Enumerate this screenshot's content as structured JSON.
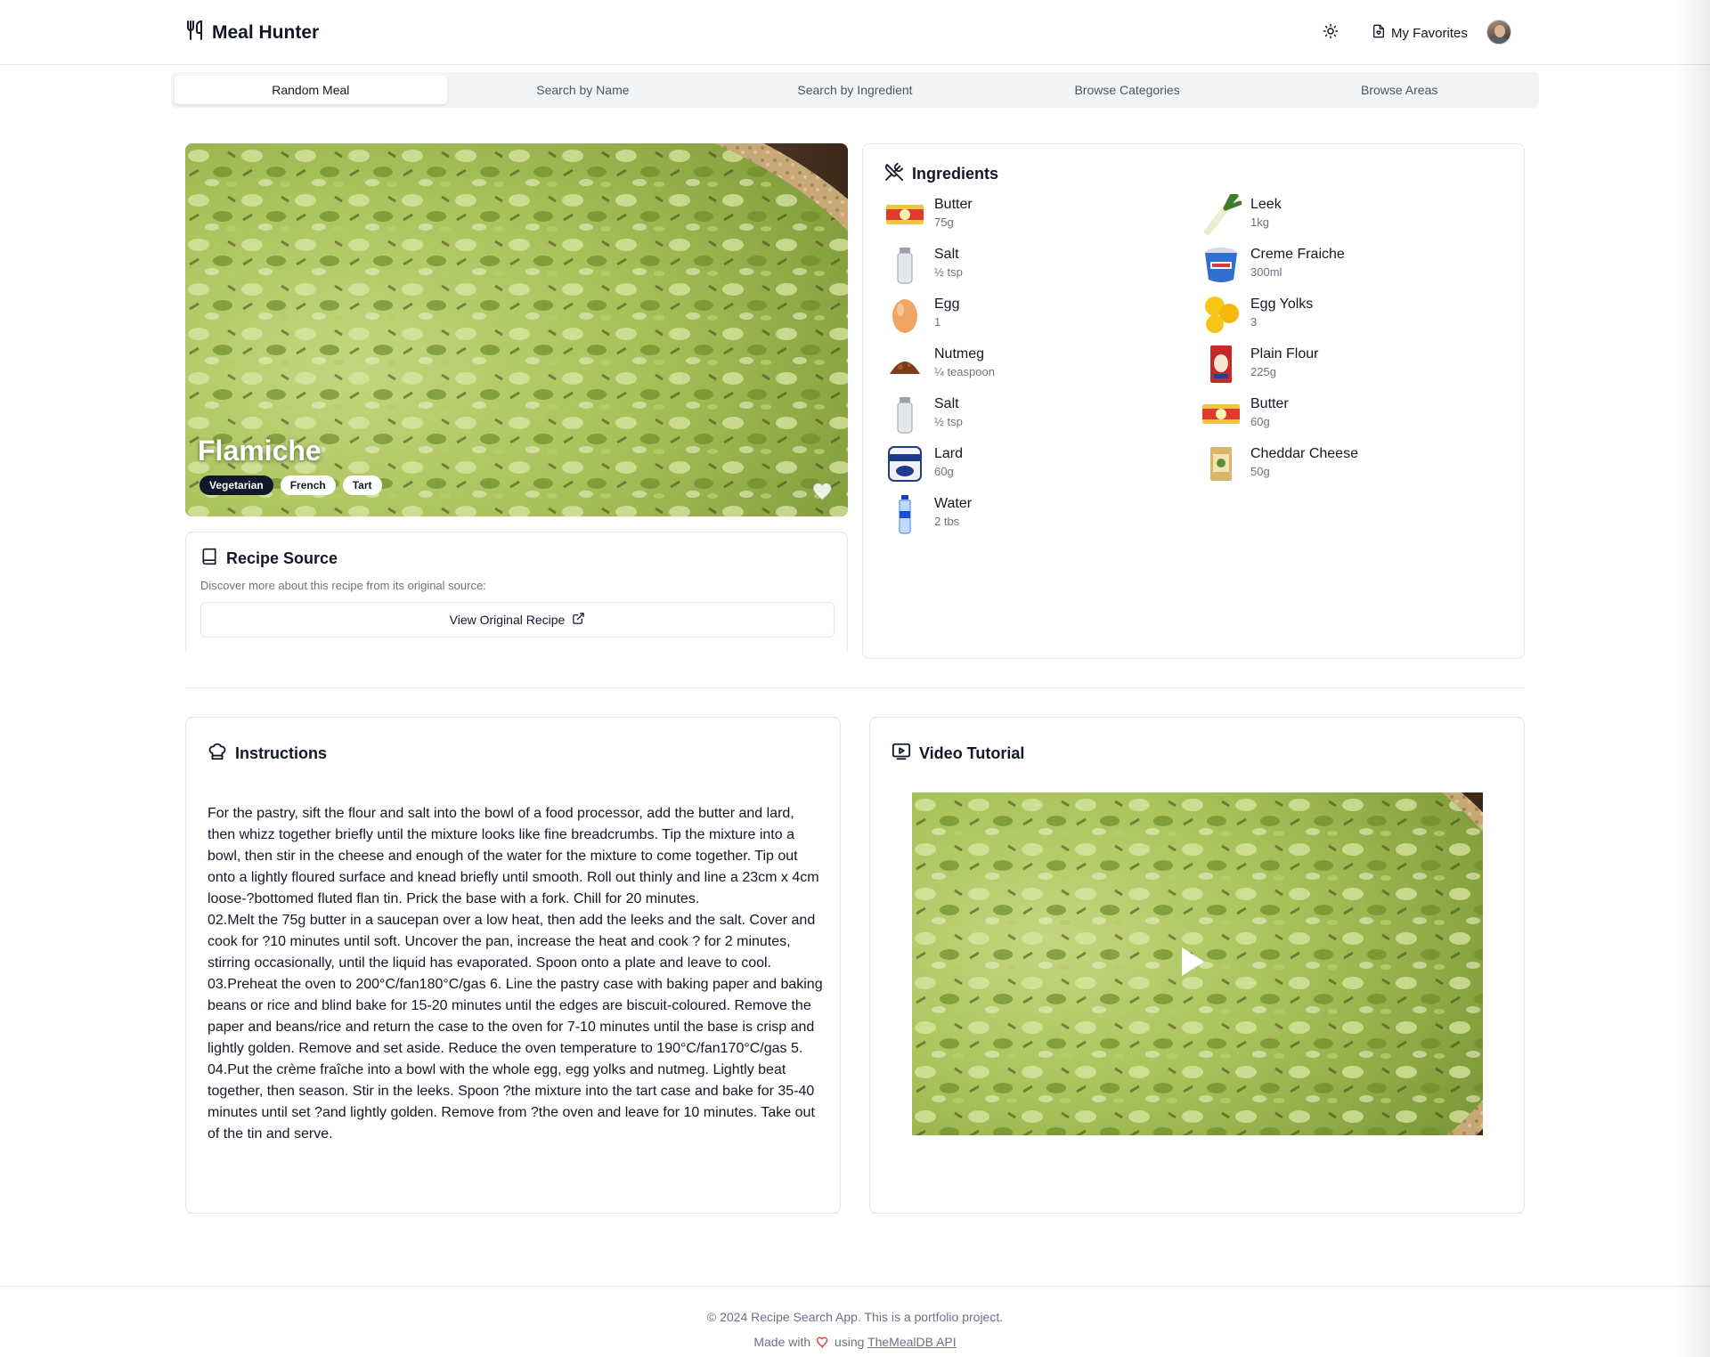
{
  "app": {
    "brand": "Meal Hunter",
    "favorites_label": "My Favorites"
  },
  "tabs": [
    {
      "label": "Random Meal",
      "active": true
    },
    {
      "label": "Search by Name",
      "active": false
    },
    {
      "label": "Search by Ingredient",
      "active": false
    },
    {
      "label": "Browse Categories",
      "active": false
    },
    {
      "label": "Browse Areas",
      "active": false
    }
  ],
  "meal": {
    "name": "Flamiche",
    "tags": [
      "Vegetarian",
      "French",
      "Tart"
    ]
  },
  "source": {
    "title": "Recipe Source",
    "description": "Discover more about this recipe from its original source:",
    "button_label": "View Original Recipe"
  },
  "ingredients": {
    "title": "Ingredients",
    "items": [
      {
        "name": "Butter",
        "measure": "75g",
        "icon": "butter-icon"
      },
      {
        "name": "Leek",
        "measure": "1kg",
        "icon": "leek-icon"
      },
      {
        "name": "Salt",
        "measure": "½ tsp",
        "icon": "salt-icon"
      },
      {
        "name": "Creme Fraiche",
        "measure": "300ml",
        "icon": "creme-fraiche-icon"
      },
      {
        "name": "Egg",
        "measure": "1",
        "icon": "egg-icon"
      },
      {
        "name": "Egg Yolks",
        "measure": "3",
        "icon": "egg-yolks-icon"
      },
      {
        "name": "Nutmeg",
        "measure": "¼ teaspoon",
        "icon": "nutmeg-icon"
      },
      {
        "name": "Plain Flour",
        "measure": "225g",
        "icon": "flour-icon"
      },
      {
        "name": "Salt",
        "measure": "½ tsp",
        "icon": "salt-icon"
      },
      {
        "name": "Butter",
        "measure": "60g",
        "icon": "butter-icon"
      },
      {
        "name": "Lard",
        "measure": "60g",
        "icon": "lard-icon"
      },
      {
        "name": "Cheddar Cheese",
        "measure": "50g",
        "icon": "cheddar-icon"
      },
      {
        "name": "Water",
        "measure": "2 tbs",
        "icon": "water-icon"
      }
    ]
  },
  "instructions": {
    "title": "Instructions",
    "text": "For the pastry, sift the flour and salt into the bowl of a food processor, add the butter and lard, then whizz together briefly until the mixture looks like fine breadcrumbs. Tip the mixture into a bowl, then stir in the cheese and enough of the water for the mixture to come together. Tip out onto a lightly floured surface and knead briefly until smooth. Roll out thinly and line a 23cm x 4cm loose-?bottomed fluted flan tin. Prick the base with a fork. Chill for 20 minutes.\n02.Melt the 75g butter in a saucepan over a low heat, then add the leeks and the salt. Cover and cook for ?10 minutes until soft. Uncover the pan, increase the heat and cook ? for 2 minutes, stirring occasionally, until the liquid has evaporated. Spoon onto a plate and leave to cool.\n03.Preheat the oven to 200°C/fan180°C/gas 6. Line the pastry case with baking paper and baking beans or rice and blind bake for 15-20 minutes until the edges are biscuit-coloured. Remove the paper and beans/rice and return the case to the oven for 7-10 minutes until the base is crisp and lightly golden. Remove and set aside. Reduce the oven temperature to 190°C/fan170°C/gas 5.\n04.Put the crème fraîche into a bowl with the whole egg, egg yolks and nutmeg. Lightly beat together, then season. Stir in the leeks. Spoon ?the mixture into the tart case and bake for 35-40 minutes until set ?and lightly golden. Remove from ?the oven and leave for 10 minutes. Take out of the tin and serve."
  },
  "video": {
    "title": "Video Tutorial"
  },
  "footer": {
    "line1": "© 2024 Recipe Search App. This is a portfolio project.",
    "made_with": "Made with",
    "using": "using",
    "api_link": "TheMealDB API"
  },
  "colors": {
    "accent_dark": "#111827",
    "muted_text": "#6b7280",
    "border": "#e5e7eb",
    "heart_red": "#ef4444"
  }
}
